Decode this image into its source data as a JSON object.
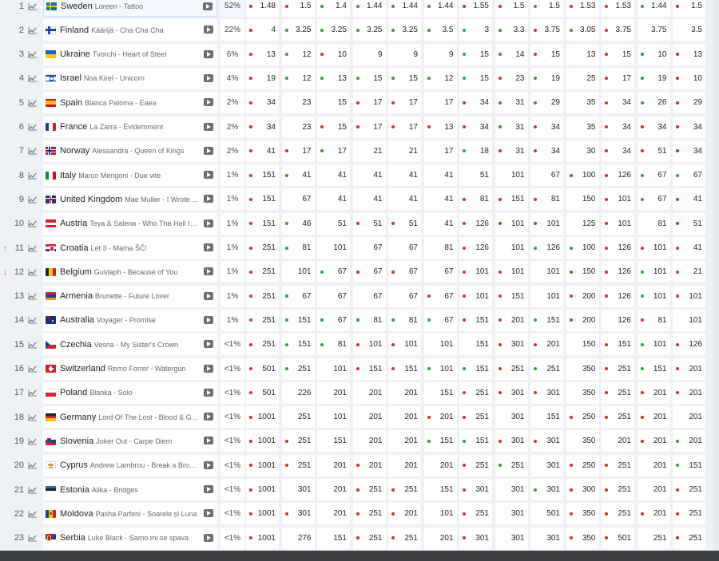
{
  "rows": [
    {
      "rank": "1",
      "move": "",
      "country": "Sweden",
      "song": "Loreen - Tattoo",
      "pct": "52%",
      "flag": "se",
      "odds": [
        [
          "1.48",
          "r"
        ],
        [
          "1.5",
          "r"
        ],
        [
          "1.4",
          "g"
        ],
        [
          "1.44",
          "g"
        ],
        [
          "1.44",
          "g"
        ],
        [
          "1.44",
          "g"
        ],
        [
          "1.55",
          "r"
        ],
        [
          "1.5",
          "r"
        ],
        [
          "1.5",
          "g"
        ],
        [
          "1.53",
          "r"
        ],
        [
          "1.53",
          "r"
        ],
        [
          "1.44",
          "g"
        ],
        [
          "1.5",
          "r"
        ]
      ]
    },
    {
      "rank": "2",
      "move": "",
      "country": "Finland",
      "song": "Käärijä - Cha Cha Cha",
      "pct": "22%",
      "flag": "fi",
      "odds": [
        [
          "4",
          "r"
        ],
        [
          "3.25",
          "g"
        ],
        [
          "3.25",
          "g"
        ],
        [
          "3.25",
          "g"
        ],
        [
          "3.25",
          "g"
        ],
        [
          "3.5",
          "g"
        ],
        [
          "3",
          "g"
        ],
        [
          "3.3",
          "g"
        ],
        [
          "3.75",
          "r"
        ],
        [
          "3.05",
          "g"
        ],
        [
          "3.75",
          "r"
        ],
        [
          "3.75",
          "n"
        ],
        [
          "3.5",
          "n"
        ]
      ]
    },
    {
      "rank": "3",
      "move": "",
      "country": "Ukraine",
      "song": "Tvorchi - Heart of Steel",
      "pct": "6%",
      "flag": "ua",
      "odds": [
        [
          "13",
          "r"
        ],
        [
          "12",
          "g"
        ],
        [
          "10",
          "r"
        ],
        [
          "9",
          "n"
        ],
        [
          "9",
          "n"
        ],
        [
          "9",
          "n"
        ],
        [
          "15",
          "g"
        ],
        [
          "14",
          "g"
        ],
        [
          "15",
          "r"
        ],
        [
          "13",
          "n"
        ],
        [
          "15",
          "r"
        ],
        [
          "10",
          "g"
        ],
        [
          "13",
          "r"
        ]
      ]
    },
    {
      "rank": "4",
      "move": "",
      "country": "Israel",
      "song": "Noa Kirel - Unicorn",
      "pct": "4%",
      "flag": "il",
      "odds": [
        [
          "19",
          "r"
        ],
        [
          "12",
          "g"
        ],
        [
          "13",
          "g"
        ],
        [
          "15",
          "g"
        ],
        [
          "15",
          "g"
        ],
        [
          "12",
          "g"
        ],
        [
          "15",
          "g"
        ],
        [
          "23",
          "r"
        ],
        [
          "19",
          "g"
        ],
        [
          "25",
          "n"
        ],
        [
          "17",
          "r"
        ],
        [
          "19",
          "g"
        ],
        [
          "10",
          "r"
        ]
      ]
    },
    {
      "rank": "5",
      "move": "",
      "country": "Spain",
      "song": "Blanca Paloma - Eaea",
      "pct": "2%",
      "flag": "es",
      "odds": [
        [
          "34",
          "r"
        ],
        [
          "23",
          "n"
        ],
        [
          "15",
          "n"
        ],
        [
          "17",
          "r"
        ],
        [
          "17",
          "r"
        ],
        [
          "17",
          "n"
        ],
        [
          "34",
          "r"
        ],
        [
          "31",
          "g"
        ],
        [
          "29",
          "g"
        ],
        [
          "35",
          "n"
        ],
        [
          "34",
          "r"
        ],
        [
          "26",
          "g"
        ],
        [
          "29",
          "r"
        ]
      ]
    },
    {
      "rank": "6",
      "move": "",
      "country": "France",
      "song": "La Zarra - Évidemment",
      "pct": "2%",
      "flag": "fr",
      "odds": [
        [
          "34",
          "r"
        ],
        [
          "23",
          "n"
        ],
        [
          "15",
          "r"
        ],
        [
          "17",
          "r"
        ],
        [
          "17",
          "r"
        ],
        [
          "13",
          "r"
        ],
        [
          "34",
          "r"
        ],
        [
          "31",
          "g"
        ],
        [
          "34",
          "r"
        ],
        [
          "35",
          "n"
        ],
        [
          "34",
          "r"
        ],
        [
          "34",
          "r"
        ],
        [
          "34",
          "r"
        ]
      ]
    },
    {
      "rank": "7",
      "move": "",
      "country": "Norway",
      "song": "Alessandra - Queen of Kings",
      "pct": "2%",
      "flag": "no",
      "odds": [
        [
          "41",
          "r"
        ],
        [
          "17",
          "r"
        ],
        [
          "17",
          "g"
        ],
        [
          "21",
          "n"
        ],
        [
          "21",
          "n"
        ],
        [
          "17",
          "n"
        ],
        [
          "18",
          "g"
        ],
        [
          "31",
          "r"
        ],
        [
          "34",
          "r"
        ],
        [
          "30",
          "n"
        ],
        [
          "34",
          "r"
        ],
        [
          "51",
          "r"
        ],
        [
          "34",
          "r"
        ]
      ]
    },
    {
      "rank": "8",
      "move": "",
      "country": "Italy",
      "song": "Marco Mengoni - Due vite",
      "pct": "1%",
      "flag": "it",
      "odds": [
        [
          "151",
          "r"
        ],
        [
          "41",
          "g"
        ],
        [
          "41",
          "n"
        ],
        [
          "41",
          "n"
        ],
        [
          "41",
          "n"
        ],
        [
          "41",
          "n"
        ],
        [
          "51",
          "n"
        ],
        [
          "101",
          "n"
        ],
        [
          "67",
          "n"
        ],
        [
          "100",
          "r"
        ],
        [
          "126",
          "r"
        ],
        [
          "67",
          "g"
        ],
        [
          "67",
          "g"
        ]
      ]
    },
    {
      "rank": "9",
      "move": "",
      "country": "United Kingdom",
      "song": "Mae Muller - I Wrote A Song",
      "pct": "1%",
      "flag": "gb",
      "odds": [
        [
          "151",
          "r"
        ],
        [
          "67",
          "n"
        ],
        [
          "41",
          "n"
        ],
        [
          "41",
          "n"
        ],
        [
          "41",
          "n"
        ],
        [
          "41",
          "n"
        ],
        [
          "81",
          "r"
        ],
        [
          "151",
          "r"
        ],
        [
          "81",
          "r"
        ],
        [
          "150",
          "n"
        ],
        [
          "101",
          "r"
        ],
        [
          "67",
          "g"
        ],
        [
          "41",
          "r"
        ]
      ]
    },
    {
      "rank": "10",
      "move": "",
      "country": "Austria",
      "song": "Teya & Salena - Who The Hell Is Edgar?",
      "pct": "1%",
      "flag": "at",
      "odds": [
        [
          "151",
          "r"
        ],
        [
          "46",
          "g"
        ],
        [
          "51",
          "n"
        ],
        [
          "51",
          "r"
        ],
        [
          "51",
          "r"
        ],
        [
          "41",
          "n"
        ],
        [
          "126",
          "r"
        ],
        [
          "101",
          "r"
        ],
        [
          "101",
          "r"
        ],
        [
          "125",
          "n"
        ],
        [
          "101",
          "r"
        ],
        [
          "81",
          "n"
        ],
        [
          "51",
          "r"
        ]
      ]
    },
    {
      "rank": "11",
      "move": "up",
      "country": "Croatia",
      "song": "Let 3 - Mama ŠČ!",
      "pct": "1%",
      "flag": "hr",
      "odds": [
        [
          "251",
          "r"
        ],
        [
          "81",
          "g"
        ],
        [
          "101",
          "n"
        ],
        [
          "67",
          "n"
        ],
        [
          "67",
          "n"
        ],
        [
          "81",
          "n"
        ],
        [
          "126",
          "r"
        ],
        [
          "101",
          "n"
        ],
        [
          "126",
          "g"
        ],
        [
          "100",
          "g"
        ],
        [
          "126",
          "r"
        ],
        [
          "101",
          "r"
        ],
        [
          "41",
          "r"
        ]
      ]
    },
    {
      "rank": "12",
      "move": "down",
      "country": "Belgium",
      "song": "Gustaph - Because of You",
      "pct": "1%",
      "flag": "be",
      "odds": [
        [
          "251",
          "r"
        ],
        [
          "101",
          "n"
        ],
        [
          "67",
          "g"
        ],
        [
          "67",
          "r"
        ],
        [
          "67",
          "r"
        ],
        [
          "67",
          "n"
        ],
        [
          "101",
          "r"
        ],
        [
          "101",
          "r"
        ],
        [
          "101",
          "n"
        ],
        [
          "150",
          "r"
        ],
        [
          "126",
          "r"
        ],
        [
          "101",
          "g"
        ],
        [
          "21",
          "r"
        ]
      ]
    },
    {
      "rank": "13",
      "move": "",
      "country": "Armenia",
      "song": "Brunette - Future Lover",
      "pct": "1%",
      "flag": "am",
      "odds": [
        [
          "251",
          "r"
        ],
        [
          "67",
          "g"
        ],
        [
          "67",
          "n"
        ],
        [
          "67",
          "n"
        ],
        [
          "67",
          "n"
        ],
        [
          "67",
          "r"
        ],
        [
          "101",
          "r"
        ],
        [
          "151",
          "r"
        ],
        [
          "101",
          "n"
        ],
        [
          "200",
          "r"
        ],
        [
          "126",
          "r"
        ],
        [
          "101",
          "g"
        ],
        [
          "101",
          "r"
        ]
      ]
    },
    {
      "rank": "14",
      "move": "",
      "country": "Australia",
      "song": "Voyager - Promise",
      "pct": "1%",
      "flag": "au",
      "odds": [
        [
          "251",
          "r"
        ],
        [
          "151",
          "g"
        ],
        [
          "67",
          "g"
        ],
        [
          "81",
          "g"
        ],
        [
          "81",
          "g"
        ],
        [
          "67",
          "g"
        ],
        [
          "151",
          "r"
        ],
        [
          "201",
          "r"
        ],
        [
          "151",
          "g"
        ],
        [
          "200",
          "r"
        ],
        [
          "126",
          "n"
        ],
        [
          "81",
          "r"
        ],
        [
          "101",
          "n"
        ]
      ]
    },
    {
      "rank": "15",
      "move": "",
      "country": "Czechia",
      "song": "Vesna - My Sister's Crown",
      "pct": "<1%",
      "flag": "cz",
      "odds": [
        [
          "251",
          "r"
        ],
        [
          "151",
          "g"
        ],
        [
          "81",
          "g"
        ],
        [
          "101",
          "r"
        ],
        [
          "101",
          "r"
        ],
        [
          "101",
          "n"
        ],
        [
          "151",
          "n"
        ],
        [
          "301",
          "r"
        ],
        [
          "201",
          "r"
        ],
        [
          "150",
          "n"
        ],
        [
          "151",
          "r"
        ],
        [
          "101",
          "g"
        ],
        [
          "126",
          "r"
        ]
      ]
    },
    {
      "rank": "16",
      "move": "",
      "country": "Switzerland",
      "song": "Remo Forrer - Watergun",
      "pct": "<1%",
      "flag": "ch",
      "odds": [
        [
          "501",
          "r"
        ],
        [
          "251",
          "g"
        ],
        [
          "101",
          "n"
        ],
        [
          "151",
          "r"
        ],
        [
          "151",
          "r"
        ],
        [
          "101",
          "g"
        ],
        [
          "151",
          "g"
        ],
        [
          "251",
          "r"
        ],
        [
          "251",
          "g"
        ],
        [
          "350",
          "n"
        ],
        [
          "251",
          "r"
        ],
        [
          "151",
          "g"
        ],
        [
          "201",
          "r"
        ]
      ]
    },
    {
      "rank": "17",
      "move": "",
      "country": "Poland",
      "song": "Blanka - Solo",
      "pct": "<1%",
      "flag": "pl",
      "odds": [
        [
          "501",
          "r"
        ],
        [
          "226",
          "n"
        ],
        [
          "201",
          "n"
        ],
        [
          "201",
          "n"
        ],
        [
          "201",
          "n"
        ],
        [
          "151",
          "n"
        ],
        [
          "251",
          "r"
        ],
        [
          "301",
          "r"
        ],
        [
          "301",
          "r"
        ],
        [
          "350",
          "n"
        ],
        [
          "251",
          "r"
        ],
        [
          "201",
          "r"
        ],
        [
          "201",
          "r"
        ]
      ]
    },
    {
      "rank": "18",
      "move": "",
      "country": "Germany",
      "song": "Lord Of The Lost - Blood & Glitter",
      "pct": "<1%",
      "flag": "de",
      "odds": [
        [
          "1001",
          "r"
        ],
        [
          "251",
          "n"
        ],
        [
          "101",
          "n"
        ],
        [
          "201",
          "n"
        ],
        [
          "201",
          "n"
        ],
        [
          "201",
          "r"
        ],
        [
          "251",
          "r"
        ],
        [
          "301",
          "n"
        ],
        [
          "151",
          "n"
        ],
        [
          "250",
          "r"
        ],
        [
          "251",
          "r"
        ],
        [
          "201",
          "r"
        ],
        [
          "201",
          "n"
        ]
      ]
    },
    {
      "rank": "19",
      "move": "",
      "country": "Slovenia",
      "song": "Joker Out - Carpe Diem",
      "pct": "<1%",
      "flag": "si",
      "odds": [
        [
          "1001",
          "r"
        ],
        [
          "251",
          "r"
        ],
        [
          "151",
          "n"
        ],
        [
          "201",
          "n"
        ],
        [
          "201",
          "n"
        ],
        [
          "151",
          "g"
        ],
        [
          "151",
          "g"
        ],
        [
          "301",
          "r"
        ],
        [
          "301",
          "r"
        ],
        [
          "350",
          "n"
        ],
        [
          "201",
          "n"
        ],
        [
          "201",
          "r"
        ],
        [
          "201",
          "g"
        ]
      ]
    },
    {
      "rank": "20",
      "move": "",
      "country": "Cyprus",
      "song": "Andrew Lambrou - Break a Broken Heart",
      "pct": "<1%",
      "flag": "cy",
      "odds": [
        [
          "1001",
          "r"
        ],
        [
          "251",
          "r"
        ],
        [
          "201",
          "n"
        ],
        [
          "201",
          "r"
        ],
        [
          "201",
          "n"
        ],
        [
          "201",
          "n"
        ],
        [
          "251",
          "r"
        ],
        [
          "251",
          "g"
        ],
        [
          "301",
          "n"
        ],
        [
          "250",
          "r"
        ],
        [
          "251",
          "r"
        ],
        [
          "201",
          "n"
        ],
        [
          "151",
          "g"
        ]
      ]
    },
    {
      "rank": "21",
      "move": "",
      "country": "Estonia",
      "song": "Alika - Bridges",
      "pct": "<1%",
      "flag": "ee",
      "odds": [
        [
          "1001",
          "r"
        ],
        [
          "301",
          "n"
        ],
        [
          "201",
          "n"
        ],
        [
          "251",
          "r"
        ],
        [
          "251",
          "r"
        ],
        [
          "151",
          "n"
        ],
        [
          "301",
          "r"
        ],
        [
          "301",
          "n"
        ],
        [
          "301",
          "g"
        ],
        [
          "300",
          "r"
        ],
        [
          "251",
          "r"
        ],
        [
          "201",
          "n"
        ],
        [
          "251",
          "r"
        ]
      ]
    },
    {
      "rank": "22",
      "move": "",
      "country": "Moldova",
      "song": "Pasha Parfeni - Soarele și Luna",
      "pct": "<1%",
      "flag": "md",
      "odds": [
        [
          "1001",
          "r"
        ],
        [
          "301",
          "r"
        ],
        [
          "201",
          "n"
        ],
        [
          "251",
          "r"
        ],
        [
          "201",
          "r"
        ],
        [
          "101",
          "n"
        ],
        [
          "251",
          "r"
        ],
        [
          "301",
          "n"
        ],
        [
          "501",
          "n"
        ],
        [
          "350",
          "r"
        ],
        [
          "251",
          "r"
        ],
        [
          "201",
          "r"
        ],
        [
          "251",
          "r"
        ]
      ]
    },
    {
      "rank": "23",
      "move": "",
      "country": "Serbia",
      "song": "Luke Black - Samo mi se spava",
      "pct": "<1%",
      "flag": "rs",
      "odds": [
        [
          "1001",
          "r"
        ],
        [
          "276",
          "n"
        ],
        [
          "151",
          "n"
        ],
        [
          "251",
          "r"
        ],
        [
          "251",
          "r"
        ],
        [
          "201",
          "n"
        ],
        [
          "301",
          "r"
        ],
        [
          "301",
          "n"
        ],
        [
          "301",
          "n"
        ],
        [
          "350",
          "r"
        ],
        [
          "501",
          "r"
        ],
        [
          "251",
          "n"
        ],
        [
          "251",
          "r"
        ]
      ]
    }
  ],
  "colors": {
    "up": "#2e9d3a",
    "down": "#d0302b",
    "accent": "#3a7bd5"
  },
  "icons": {
    "chart": "trend-chart-icon",
    "video": "video-play-icon"
  },
  "move_glyphs": {
    "up": "↑",
    "down": "↓"
  }
}
